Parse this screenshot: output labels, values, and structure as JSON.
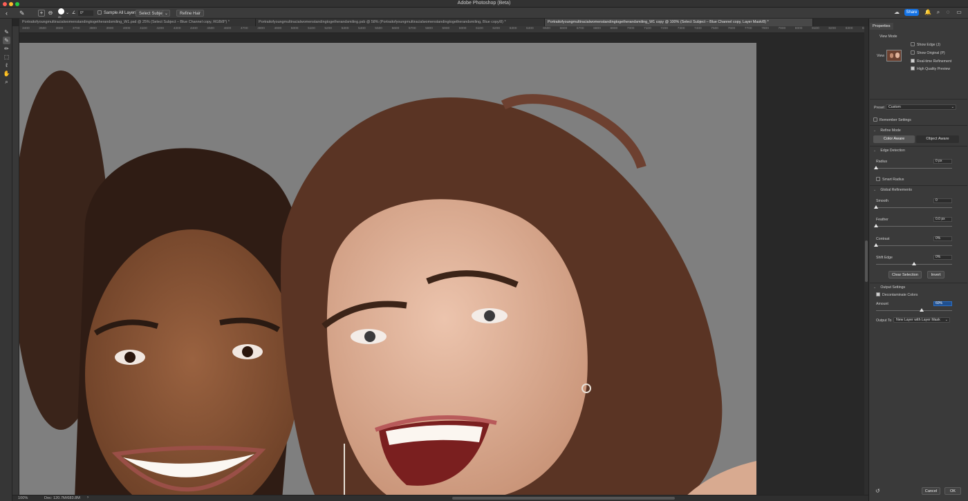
{
  "app": {
    "title": "Adobe Photoshop (Beta)"
  },
  "options_bar": {
    "brush_size": "20",
    "angle": "0°",
    "sample_all_layers": "Sample All Layers",
    "select_subject": "Select Subject",
    "refine_hair": "Refine Hair",
    "share": "Share"
  },
  "tabs": [
    {
      "label": "Portraitofyoungmultiracialwomenstandingtogetherandsmiling_W1.psd @ 25% (Select Subject – Blue Channel copy, RGB/8*) *"
    },
    {
      "label": "Portraitofyoungmultiracialwomenstandingtogetherandsmiling.psb @ 58% (Portraitofyoungmultiracialwomenstandingtogetherandsmiling, Blue copy/8) *"
    },
    {
      "label": "Portraitofyoungmultiracialwomenstandingtogetherandsmiling_W1 copy @ 100% (Select Subject – Blue Channel copy, Layer Mask/8) *"
    }
  ],
  "ruler": [
    "3400",
    "3500",
    "3600",
    "3700",
    "3800",
    "3900",
    "4000",
    "4100",
    "4200",
    "4300",
    "4400",
    "4500",
    "4600",
    "4700",
    "4800",
    "4900",
    "5000",
    "5100",
    "5200",
    "5300",
    "5400",
    "5500",
    "5600",
    "5700",
    "5800",
    "5900",
    "6000",
    "6100",
    "6200",
    "6300",
    "6400",
    "6500",
    "6600",
    "6700",
    "6800",
    "6900",
    "7000",
    "7100",
    "7200",
    "7300",
    "7400",
    "7500",
    "7600",
    "7700",
    "7800",
    "7900",
    "8000",
    "8100",
    "8200",
    "8300",
    "8400"
  ],
  "status": {
    "zoom": "100%",
    "doc": "Doc: 120.7M/683.8M"
  },
  "properties": {
    "tab": "Properties",
    "view_mode": "View Mode",
    "view": "View",
    "show_edge": "Show Edge (J)",
    "show_original": "Show Original (P)",
    "realtime_refinement": "Real-time Refinement",
    "high_quality_preview": "High Quality Preview",
    "preset_label": "Preset",
    "preset_value": "Custom",
    "remember_settings": "Remember Settings",
    "refine_mode": "Refine Mode",
    "color_aware": "Color Aware",
    "object_aware": "Object Aware",
    "edge_detection": "Edge Detection",
    "radius": "Radius",
    "radius_value": "0 px",
    "smart_radius": "Smart Radius",
    "global_refinements": "Global Refinements",
    "smooth": "Smooth",
    "smooth_value": "0",
    "feather": "Feather",
    "feather_value": "0.0 px",
    "contrast": "Contrast",
    "contrast_value": "0%",
    "shift_edge": "Shift Edge",
    "shift_edge_value": "0%",
    "clear_selection": "Clear Selection",
    "invert": "Invert",
    "output_settings": "Output Settings",
    "decontaminate": "Decontaminate Colors",
    "amount": "Amount",
    "amount_value": "60%",
    "output_to": "Output To",
    "output_value": "New Layer with Layer Mask",
    "cancel": "Cancel",
    "ok": "OK"
  },
  "sliders": {
    "radius": 0,
    "smooth": 0,
    "feather": 0,
    "contrast": 0,
    "shift_edge": 0.5,
    "amount": 0.6
  },
  "colors": {
    "accent": "#1473e6",
    "canvas_bg": "#7d7d7d",
    "hair": "#5a3424",
    "skin_left": "#8a5535",
    "skin_right": "#d8aa90"
  }
}
